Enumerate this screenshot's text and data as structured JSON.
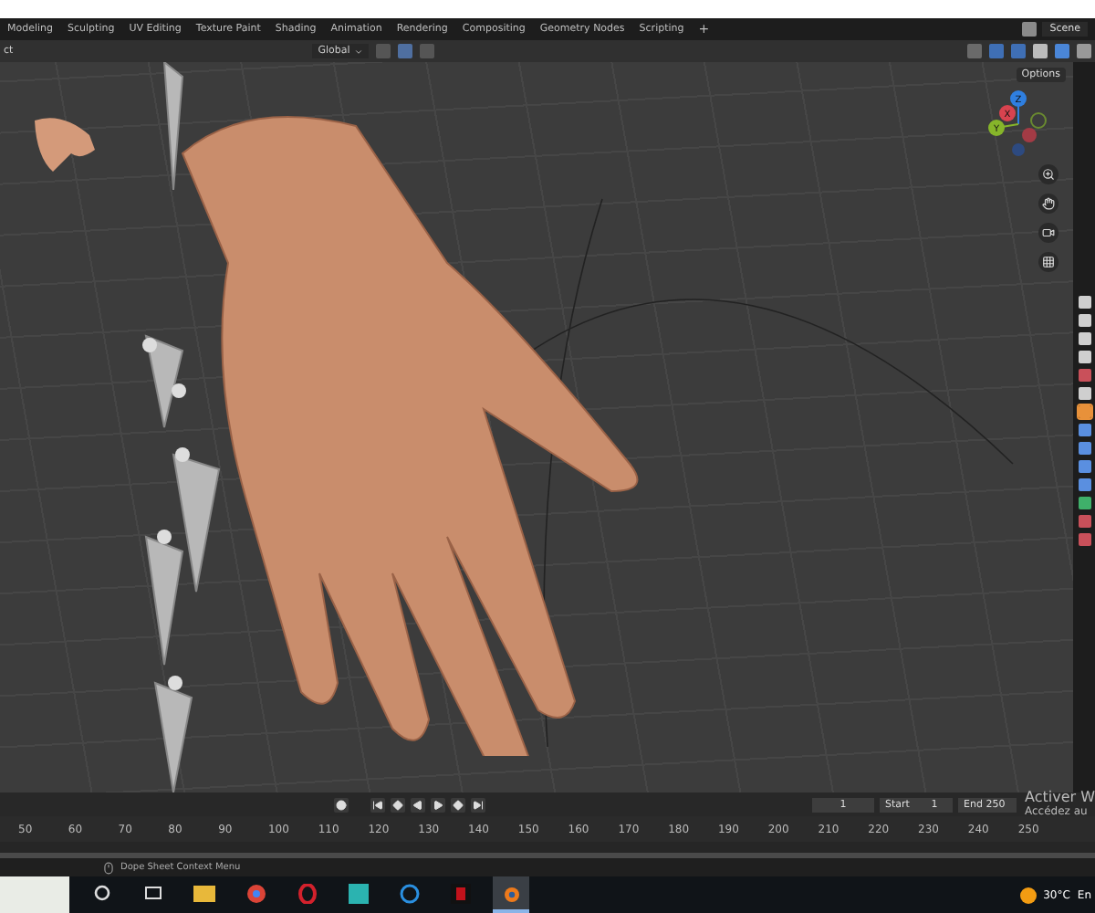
{
  "workspace_tabs": [
    "Modeling",
    "Sculpting",
    "UV Editing",
    "Texture Paint",
    "Shading",
    "Animation",
    "Rendering",
    "Compositing",
    "Geometry Nodes",
    "Scripting"
  ],
  "add_workspace": "+",
  "scene": "Scene",
  "header": {
    "mode_label": "ct",
    "orientation": "Global"
  },
  "viewport": {
    "options": "Options",
    "axes": [
      {
        "label": "Z",
        "color": "#2f7fe0"
      },
      {
        "label": "X",
        "color": "#d8434f"
      },
      {
        "label": "Y",
        "color": "#86b52a"
      }
    ]
  },
  "property_tabs": [
    {
      "color": "#cfcfcf",
      "selected": false
    },
    {
      "color": "#cfcfcf",
      "selected": false
    },
    {
      "color": "#cfcfcf",
      "selected": false
    },
    {
      "color": "#cfcfcf",
      "selected": false
    },
    {
      "color": "#c9505a",
      "selected": false
    },
    {
      "color": "#cfcfcf",
      "selected": false
    },
    {
      "color": "#e8913a",
      "selected": true
    },
    {
      "color": "#5a8fe0",
      "selected": false
    },
    {
      "color": "#5a8fe0",
      "selected": false
    },
    {
      "color": "#5a8fe0",
      "selected": false
    },
    {
      "color": "#5a8fe0",
      "selected": false
    },
    {
      "color": "#3fb06a",
      "selected": false
    },
    {
      "color": "#c9505a",
      "selected": false
    },
    {
      "color": "#c9505a",
      "selected": false
    }
  ],
  "timeline": {
    "current_frame": "1",
    "start_label": "Start",
    "start": "1",
    "end_label": "End",
    "end": "250",
    "ruler": [
      "50",
      "60",
      "70",
      "80",
      "90",
      "100",
      "110",
      "120",
      "130",
      "140",
      "150",
      "160",
      "170",
      "180",
      "190",
      "200",
      "210",
      "220",
      "230",
      "240",
      "250"
    ]
  },
  "activation_notice": [
    "Activer W",
    "Accédez au"
  ],
  "status": {
    "hint": "Dope Sheet Context Menu"
  },
  "taskbar": {
    "apps": [
      {
        "kind": "search",
        "selected": false
      },
      {
        "kind": "taskview",
        "selected": false
      },
      {
        "kind": "folder",
        "selected": false
      },
      {
        "kind": "chrome",
        "selected": false
      },
      {
        "kind": "opera",
        "selected": false
      },
      {
        "kind": "tile",
        "selected": false
      },
      {
        "kind": "ring",
        "selected": false
      },
      {
        "kind": "dark",
        "selected": false
      },
      {
        "kind": "blender",
        "selected": true
      }
    ],
    "temperature": "30°C",
    "language": "En"
  }
}
